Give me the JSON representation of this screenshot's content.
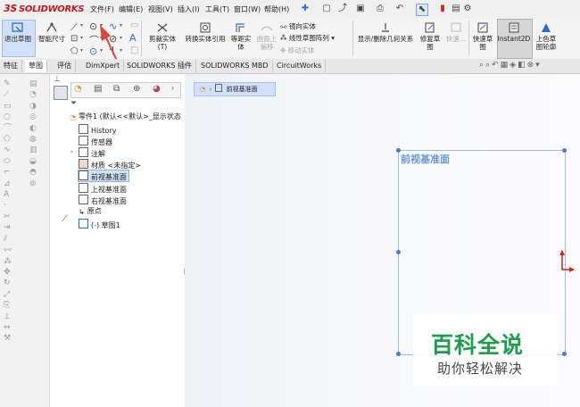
{
  "app": {
    "logo_text": "SOLIDWORKS",
    "logo_prefix": "3S"
  },
  "menu": [
    {
      "name": "menu-file",
      "label": "文件(F)"
    },
    {
      "name": "menu-edit",
      "label": "编辑(E)"
    },
    {
      "name": "menu-view",
      "label": "视图(V)"
    },
    {
      "name": "menu-insert",
      "label": "插入(I)"
    },
    {
      "name": "menu-tools",
      "label": "工具(T)"
    },
    {
      "name": "menu-window",
      "label": "窗口(W)"
    },
    {
      "name": "menu-help",
      "label": "帮助(H)"
    }
  ],
  "toolbar": {
    "exit_sketch": "退出草图",
    "smart_dimension": "智能尺寸",
    "trim_entities": "剪裁实体(T)",
    "convert_entities": "转换实体引用",
    "offset_entities": [
      "等距实",
      "体"
    ],
    "surface_offset": [
      "曲面上",
      "偏移"
    ],
    "mirror_entities": "镜向实体",
    "linear_pattern": "线性草图阵列",
    "move_entities": "移动实体",
    "display_relations": "显示/删除几何关系",
    "repair_sketch": [
      "修复草",
      "图"
    ],
    "quick_snaps": "快速...",
    "rapid_sketch": [
      "快速草",
      "图"
    ],
    "instant2d": "Instant2D",
    "shaded_sketch": [
      "上色草",
      "图轮廓"
    ]
  },
  "tabs": [
    {
      "name": "tab-features",
      "label": "特征",
      "active": false
    },
    {
      "name": "tab-sketch",
      "label": "草图",
      "active": true
    },
    {
      "name": "tab-evaluate",
      "label": "评估",
      "active": false
    },
    {
      "name": "tab-dimxpert",
      "label": "DimXpert",
      "active": false
    },
    {
      "name": "tab-addins",
      "label": "SOLIDWORKS 插件",
      "active": false
    },
    {
      "name": "tab-mbd",
      "label": "SOLIDWORKS MBD",
      "active": false
    },
    {
      "name": "tab-circuitworks",
      "label": "CircuitWorks",
      "active": false
    }
  ],
  "tree": {
    "root": "零件1 (默认<<默认>_显示状态",
    "items": [
      {
        "name": "tree-history",
        "label": "History",
        "icon": "history-icon"
      },
      {
        "name": "tree-sensors",
        "label": "传感器",
        "icon": "sensor-icon"
      },
      {
        "name": "tree-annotations",
        "label": "注解",
        "icon": "annotation-icon"
      },
      {
        "name": "tree-material",
        "label": "材质 <未指定>",
        "icon": "material-icon"
      },
      {
        "name": "tree-front-plane",
        "label": "前视基准面",
        "icon": "plane-icon",
        "selected": true
      },
      {
        "name": "tree-top-plane",
        "label": "上视基准面",
        "icon": "plane-icon"
      },
      {
        "name": "tree-right-plane",
        "label": "右视基准面",
        "icon": "plane-icon"
      },
      {
        "name": "tree-origin",
        "label": "原点",
        "icon": "origin-icon"
      },
      {
        "name": "tree-sketch1",
        "label": "(-) 草图1",
        "icon": "sketch-icon"
      }
    ]
  },
  "breadcrumb": {
    "label": "前视基准面"
  },
  "graphics": {
    "plane_label": "前视基准面"
  },
  "watermark": {
    "title": "百科全说",
    "subtitle": "助你轻松解决"
  },
  "colors": {
    "plane_border": "#9fbde6",
    "plane_label": "#6b97d6",
    "selection": "#cfe0f7",
    "arrow": "#e0453a",
    "watermark_green": "#1e9d4b"
  }
}
